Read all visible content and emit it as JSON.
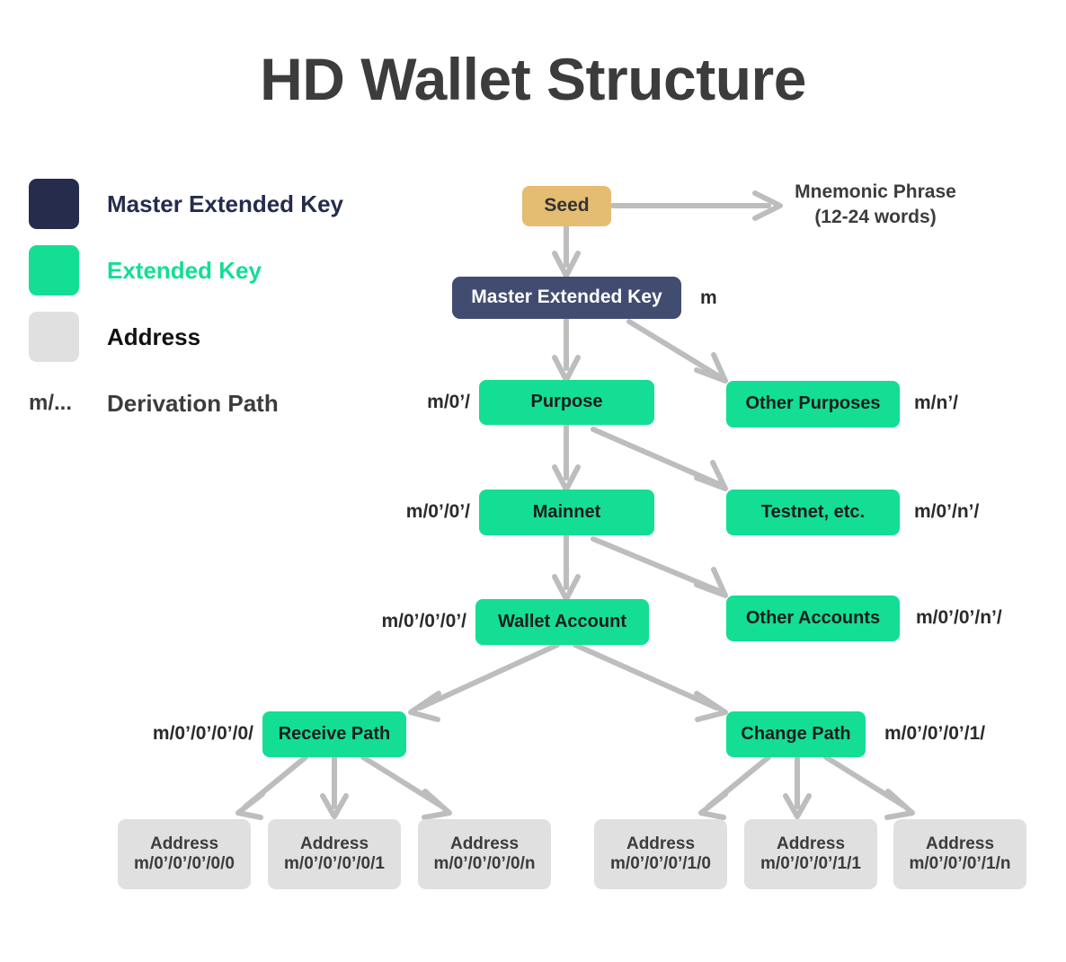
{
  "page": {
    "title": "HD Wallet Structure",
    "background_color": "#ffffff",
    "title_color": "#3c3c3c"
  },
  "legend": {
    "items": [
      {
        "key": "master-extended-key",
        "swatch_color": "#252c4c",
        "label": "Master Extended Key",
        "label_color": "#252c4c",
        "swatch_type": "square"
      },
      {
        "key": "extended-key",
        "swatch_color": "#13de94",
        "label": "Extended Key",
        "label_color": "#13de94",
        "swatch_type": "square"
      },
      {
        "key": "address",
        "swatch_color": "#e0e0e0",
        "label": "Address",
        "label_color": "#111111",
        "swatch_type": "square"
      },
      {
        "key": "derivation-path",
        "swatch_text": "m/...",
        "label": "Derivation Path",
        "label_color": "#3c3c3c",
        "swatch_type": "text"
      }
    ]
  },
  "diagram": {
    "arrow_color": "#bdbdbd",
    "nodes": {
      "seed": {
        "label": "Seed",
        "color": "#e4bc72",
        "text_color": "#333333"
      },
      "master": {
        "label": "Master Extended Key",
        "color": "#414c70",
        "text_color": "#ffffff",
        "path": "m"
      },
      "purpose": {
        "label": "Purpose",
        "color": "#13de94",
        "path": "m/0’/"
      },
      "other_purposes": {
        "label": "Other Purposes",
        "color": "#13de94",
        "path": "m/n’/"
      },
      "mainnet": {
        "label": "Mainnet",
        "color": "#13de94",
        "path": "m/0’/0’/"
      },
      "testnet": {
        "label": "Testnet, etc.",
        "color": "#13de94",
        "path": "m/0’/n’/"
      },
      "wallet_account": {
        "label": "Wallet Account",
        "color": "#13de94",
        "path": "m/0’/0’/0’/"
      },
      "other_accounts": {
        "label": "Other Accounts",
        "color": "#13de94",
        "path": "m/0’/0’/n’/"
      },
      "receive_path": {
        "label": "Receive Path",
        "color": "#13de94",
        "path": "m/0’/0’/0’/0/"
      },
      "change_path": {
        "label": "Change Path",
        "color": "#13de94",
        "path": "m/0’/0’/0’/1/"
      }
    },
    "mnemonic_note": {
      "line1": "Mnemonic Phrase",
      "line2": "(12-24 words)"
    },
    "addresses": [
      {
        "title": "Address",
        "path": "m/0’/0’/0’/0/0",
        "group": "receive"
      },
      {
        "title": "Address",
        "path": "m/0’/0’/0’/0/1",
        "group": "receive"
      },
      {
        "title": "Address",
        "path": "m/0’/0’/0’/0/n",
        "group": "receive"
      },
      {
        "title": "Address",
        "path": "m/0’/0’/0’/1/0",
        "group": "change"
      },
      {
        "title": "Address",
        "path": "m/0’/0’/0’/1/1",
        "group": "change"
      },
      {
        "title": "Address",
        "path": "m/0’/0’/0’/1/n",
        "group": "change"
      }
    ]
  }
}
